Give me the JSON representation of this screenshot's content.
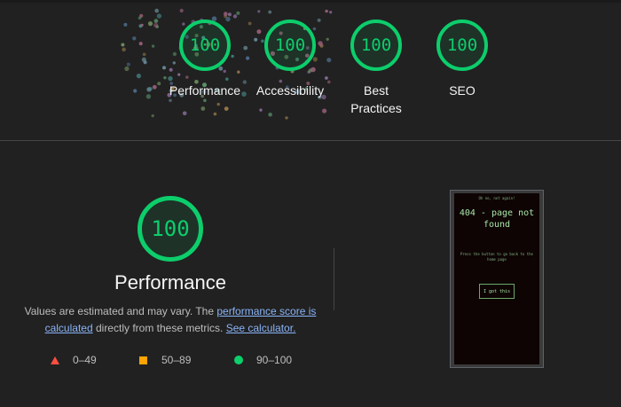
{
  "summary_gauges": [
    {
      "score": "100",
      "label": "Performance"
    },
    {
      "score": "100",
      "label": "Accessibility"
    },
    {
      "score": "100",
      "label": "Best Practices"
    },
    {
      "score": "100",
      "label": "SEO"
    }
  ],
  "performance": {
    "score": "100",
    "title": "Performance",
    "desc_prefix": "Values are estimated and may vary. The ",
    "desc_link1": "performance score is calculated",
    "desc_mid": " directly from these metrics. ",
    "desc_link2": "See calculator."
  },
  "legend": {
    "fail": "0–49",
    "average": "50–89",
    "pass": "90–100"
  },
  "final_screenshot": {
    "top_text": "Oh no, not again!",
    "title": "404 - page not found",
    "message": "Press the button to go back to the home page",
    "button": "I got this"
  },
  "colors": {
    "pass": "#0cce6b",
    "average": "#ffa400",
    "fail": "#ff4e42",
    "link": "#8ab4f8",
    "background": "#212121"
  }
}
